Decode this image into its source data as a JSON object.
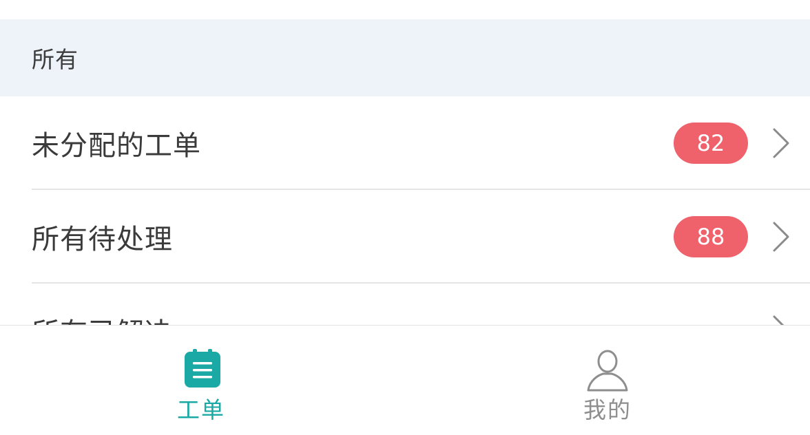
{
  "section": {
    "title": "所有"
  },
  "list_items": [
    {
      "label": "未分配的工单",
      "badge": "82"
    },
    {
      "label": "所有待处理",
      "badge": "88"
    },
    {
      "label": "所有已解决",
      "badge": ""
    }
  ],
  "bottom_nav": {
    "tabs": [
      {
        "label": "工单",
        "icon": "clipboard-list-icon",
        "active": true
      },
      {
        "label": "我的",
        "icon": "user-profile-icon",
        "active": false
      }
    ]
  },
  "colors": {
    "accent": "#1aa9a4",
    "badge": "#f0626b",
    "inactive": "#8e8e8e",
    "header_bg": "#eef3f9",
    "divider": "#e4e4e4",
    "chevron": "#8a8a8a"
  }
}
